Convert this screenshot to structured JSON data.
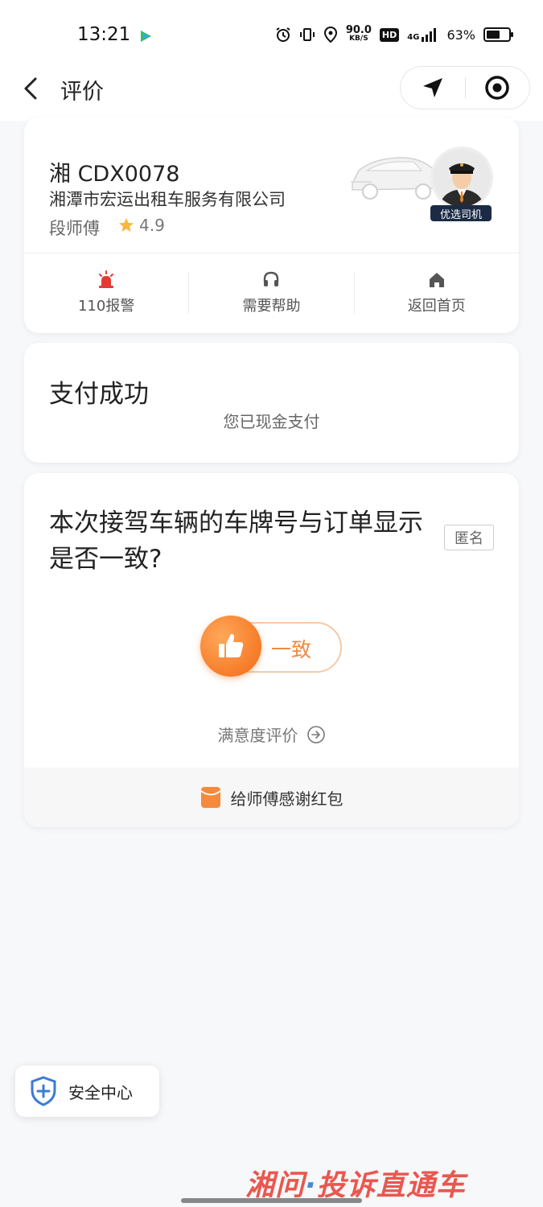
{
  "status_bar": {
    "time": "13:21",
    "net_speed_value": "90.0",
    "net_speed_unit": "KB/S",
    "hd": "HD",
    "signal": "4G",
    "battery": "63%",
    "battery_level": 0.63
  },
  "nav": {
    "title": "评价",
    "back_icon": "chevron-left-icon",
    "location_icon": "navigation-arrow-icon",
    "record_icon": "target-circle-icon"
  },
  "driver_card": {
    "plate": "湘 CDX0078",
    "company": "湘潭市宏运出租车服务有限公司",
    "driver_name": "段师傅",
    "rating": "4.9",
    "badge": "优选司机",
    "actions": [
      {
        "label": "110报警",
        "icon": "alarm-siren-icon"
      },
      {
        "label": "需要帮助",
        "icon": "headset-icon"
      },
      {
        "label": "返回首页",
        "icon": "home-icon"
      }
    ]
  },
  "payment_card": {
    "title": "支付成功",
    "subtitle": "您已现金支付"
  },
  "evaluation_card": {
    "question": "本次接驾车辆的车牌号与订单显示是否一致?",
    "anonymous_tag": "匿名",
    "consistent_button": "一致",
    "satisfaction_link": "满意度评价",
    "red_packet_label": "给师傅感谢红包"
  },
  "safety_center": {
    "label": "安全中心"
  },
  "watermark": {
    "part1": "湘问",
    "dot": "·",
    "part2": "投诉直通车"
  },
  "colors": {
    "accent_orange": "#f26a13",
    "alarm_red": "#e53935",
    "safety_blue": "#3a7bd5"
  }
}
